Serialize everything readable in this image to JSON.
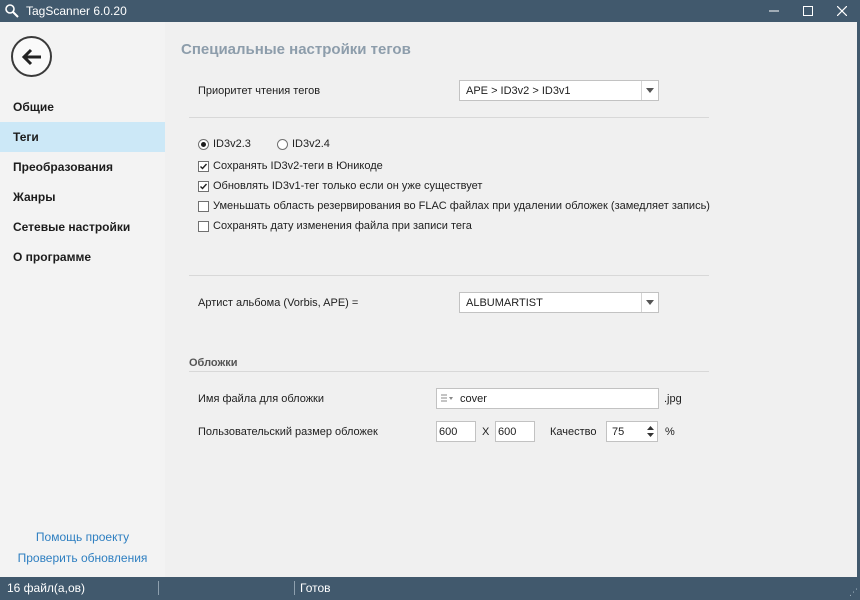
{
  "window": {
    "title": "TagScanner 6.0.20",
    "minimize": "—",
    "maximize": "☐",
    "close": "✕"
  },
  "sidebar": {
    "items": [
      {
        "label": "Общие",
        "active": false
      },
      {
        "label": "Теги",
        "active": true
      },
      {
        "label": "Преобразования",
        "active": false
      },
      {
        "label": "Жанры",
        "active": false
      },
      {
        "label": "Сетевые настройки",
        "active": false
      },
      {
        "label": "О программе",
        "active": false
      }
    ],
    "links": [
      "Помощь проекту",
      "Проверить обновления"
    ]
  },
  "main": {
    "title": "Специальные настройки тегов",
    "priority_label": "Приоритет чтения тегов",
    "priority_value": "APE > ID3v2 > ID3v1",
    "id3_versions": [
      {
        "label": "ID3v2.3",
        "checked": true
      },
      {
        "label": "ID3v2.4",
        "checked": false
      }
    ],
    "options": [
      {
        "label": "Сохранять ID3v2-теги в Юникоде",
        "checked": true
      },
      {
        "label": "Обновлять ID3v1-тег только если он уже существует",
        "checked": true
      },
      {
        "label": "Уменьшать область резервирования во FLAC файлах при удалении обложек  (замедляет запись)",
        "checked": false
      },
      {
        "label": "Сохранять дату изменения файла при записи тега",
        "checked": false
      }
    ],
    "album_artist_label": "Артист альбома (Vorbis, APE) =",
    "album_artist_value": "ALBUMARTIST",
    "covers": {
      "section_title": "Обложки",
      "filename_label": "Имя файла для обложки",
      "filename_value": "cover",
      "filename_ext": ".jpg",
      "size_label": "Пользовательский размер обложек",
      "width": "600",
      "x_sep": "X",
      "height": "600",
      "quality_label": "Качество",
      "quality_value": "75",
      "percent": "%"
    }
  },
  "status": {
    "files": "16 файл(а,ов)",
    "state": "Готов"
  }
}
